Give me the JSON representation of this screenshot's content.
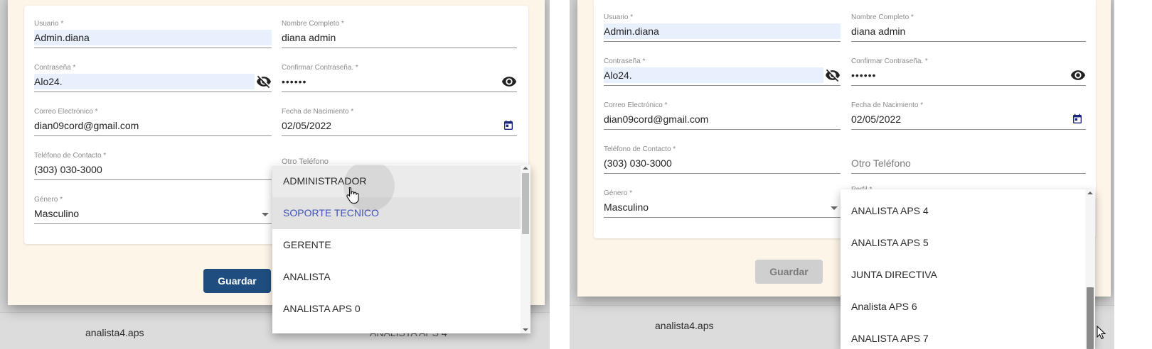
{
  "form": {
    "usuario": {
      "label": "Usuario *",
      "value": "Admin.diana"
    },
    "nombre": {
      "label": "Nombre Completo *",
      "value": "diana admin"
    },
    "contrasena": {
      "label": "Contraseña *",
      "value": "Alo24.",
      "icon": "visibility-off-icon"
    },
    "confirmar": {
      "label": "Confirmar Contraseña. *",
      "value": "••••••",
      "icon": "visibility-icon"
    },
    "correo": {
      "label": "Correo Electrónico *",
      "value": "dian09cord@gmail.com"
    },
    "fecha": {
      "label": "Fecha de Nacimiento *",
      "value": "02/05/2022",
      "icon": "calendar-icon"
    },
    "telefono": {
      "label": "Teléfono de Contacto *",
      "value": "(303) 030-3000"
    },
    "otro_telefono": {
      "label_partial": "Otro Teléfono",
      "placeholder": "Otro Teléfono"
    },
    "genero": {
      "label": "Género *",
      "value": "Masculino"
    },
    "perfil": {
      "label_partial": "Perfil *"
    },
    "guardar_label": "Guardar"
  },
  "left_menu": {
    "items": [
      "ADMINISTRADOR",
      "SOPORTE TECNICO",
      "GERENTE",
      "ANALISTA",
      "ANALISTA APS 0"
    ],
    "selected": "SOPORTE TECNICO",
    "hovered": "ADMINISTRADOR"
  },
  "right_menu": {
    "items": [
      "ANALISTA APS 4",
      "ANALISTA APS 5",
      "JUNTA DIRECTIVA",
      "Analista APS 6",
      "ANALISTA APS 7"
    ]
  },
  "background_table": {
    "left_username": "analista4.aps",
    "left_profile_partial": "ANALISTA APS 4",
    "right_username": "analista4.aps"
  },
  "colors": {
    "primary_button": "#1f4d7f",
    "selected_item": "#3f51b5",
    "dialog_bg": "#fdf5e8",
    "autofill_bg": "#e8f0fe"
  }
}
